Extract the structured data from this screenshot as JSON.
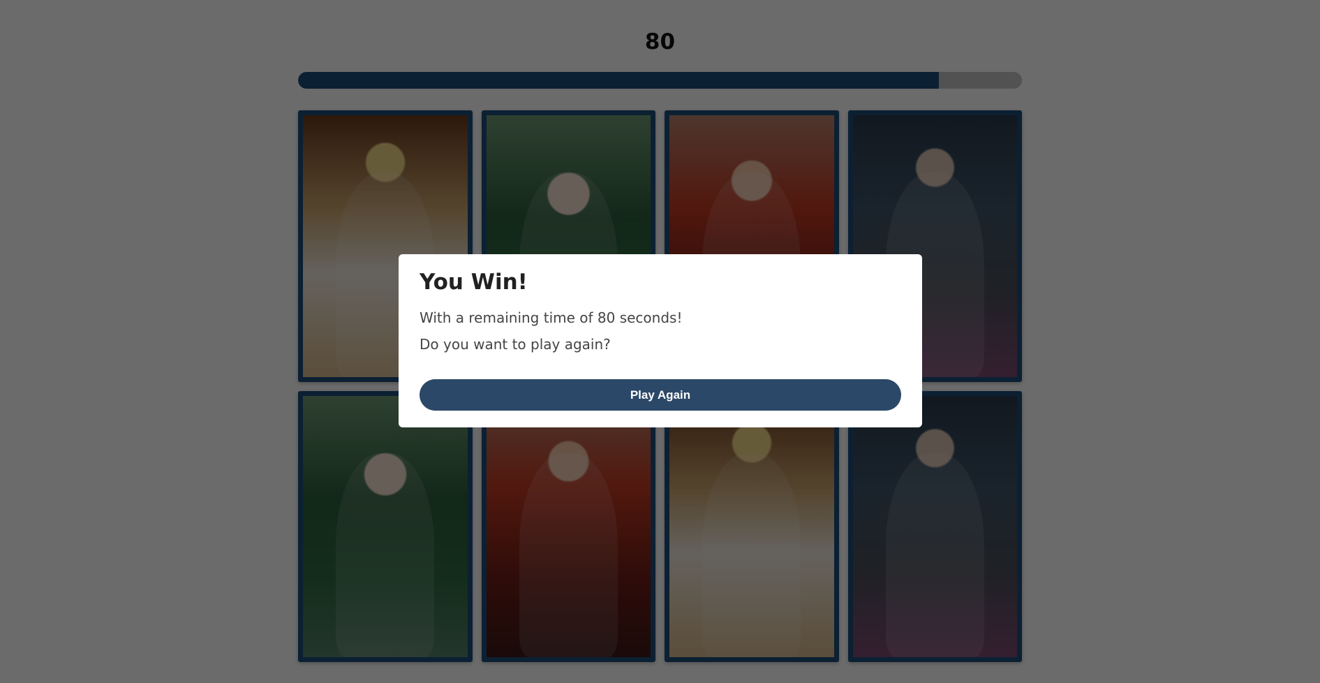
{
  "game": {
    "timer_value": "80",
    "progress_fraction": 0.885
  },
  "cards": [
    {
      "art": "angel-character-card"
    },
    {
      "art": "elf-character-card"
    },
    {
      "art": "demon-character-card"
    },
    {
      "art": "knight-character-card"
    },
    {
      "art": "elf-character-card"
    },
    {
      "art": "demon-character-card"
    },
    {
      "art": "angel-character-card"
    },
    {
      "art": "knight-character-card"
    }
  ],
  "modal": {
    "title": "You Win!",
    "message": "With a remaining time of 80 seconds!",
    "question": "Do you want to play again?",
    "button_label": "Play Again"
  },
  "colors": {
    "accent": "#1d4d79",
    "button": "#2c4868",
    "overlay": "rgba(0,0,0,0.58)"
  }
}
